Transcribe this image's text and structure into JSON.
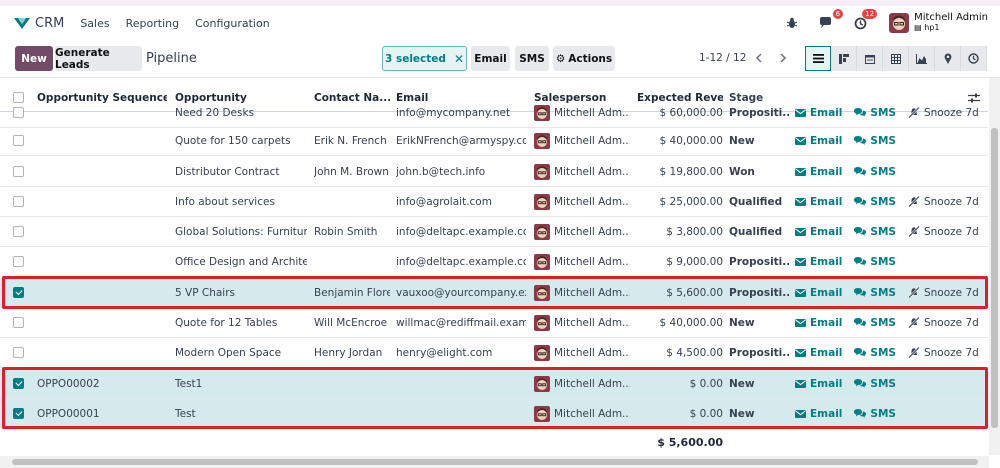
{
  "navbar": {
    "app_name": "CRM",
    "menu": [
      "Sales",
      "Reporting",
      "Configuration"
    ],
    "messages_badge": "6",
    "activities_badge": "12",
    "user_name": "Mitchell Admin",
    "user_db": "hp1"
  },
  "control": {
    "new_label": "New",
    "generate_label": "Generate Leads",
    "title": "Pipeline",
    "selected_label": "3 selected",
    "email_label": "Email",
    "sms_label": "SMS",
    "actions_label": "Actions",
    "pager": "1-12 / 12"
  },
  "colors": {
    "brand": "#714b67",
    "accent": "#017e84",
    "highlight": "#e11d2b",
    "selected_row": "#d5eaec"
  },
  "table": {
    "columns": [
      "Opportunity Sequence C...",
      "Opportunity",
      "Contact Na...",
      "Email",
      "Salesperson",
      "Expected Reven...",
      "Stage"
    ],
    "rows": [
      {
        "selected": false,
        "seq": "",
        "opp": "Need 20 Desks",
        "contact": "",
        "email": "info@mycompany.net",
        "sales": "Mitchell Adm...",
        "rev": "$ 60,000.00",
        "stage": "Propositi...",
        "email_act": "Email",
        "sms_act": "SMS",
        "snooze": "Snooze 7d"
      },
      {
        "selected": false,
        "seq": "",
        "opp": "Quote for 150 carpets",
        "contact": "Erik N. French",
        "email": "ErikNFrench@armyspy.com",
        "sales": "Mitchell Adm...",
        "rev": "$ 40,000.00",
        "stage": "New",
        "email_act": "Email",
        "sms_act": "SMS",
        "snooze": ""
      },
      {
        "selected": false,
        "seq": "",
        "opp": "Distributor Contract",
        "contact": "John M. Brown",
        "email": "john.b@tech.info",
        "sales": "Mitchell Adm...",
        "rev": "$ 19,800.00",
        "stage": "Won",
        "email_act": "Email",
        "sms_act": "SMS",
        "snooze": ""
      },
      {
        "selected": false,
        "seq": "",
        "opp": "Info about services",
        "contact": "",
        "email": "info@agrolait.com",
        "sales": "Mitchell Adm...",
        "rev": "$ 25,000.00",
        "stage": "Qualified",
        "email_act": "Email",
        "sms_act": "SMS",
        "snooze": "Snooze 7d"
      },
      {
        "selected": false,
        "seq": "",
        "opp": "Global Solutions: Furnitures",
        "contact": "Robin Smith",
        "email": "info@deltapc.example.com",
        "sales": "Mitchell Adm...",
        "rev": "$ 3,800.00",
        "stage": "Qualified",
        "email_act": "Email",
        "sms_act": "SMS",
        "snooze": "Snooze 7d"
      },
      {
        "selected": false,
        "seq": "",
        "opp": "Office Design and Architect...",
        "contact": "",
        "email": "info@deltapc.example.com",
        "sales": "Mitchell Adm...",
        "rev": "$ 9,000.00",
        "stage": "Propositi...",
        "email_act": "Email",
        "sms_act": "SMS",
        "snooze": ""
      },
      {
        "selected": true,
        "seq": "",
        "opp": "5 VP Chairs",
        "contact": "Benjamin Flores",
        "email": "vauxoo@yourcompany.exa...",
        "sales": "Mitchell Adm...",
        "rev": "$ 5,600.00",
        "stage": "Propositi...",
        "email_act": "Email",
        "sms_act": "SMS",
        "snooze": "Snooze 7d"
      },
      {
        "selected": false,
        "seq": "",
        "opp": "Quote for 12 Tables",
        "contact": "Will McEncroe",
        "email": "willmac@rediffmail.exampl...",
        "sales": "Mitchell Adm...",
        "rev": "$ 40,000.00",
        "stage": "New",
        "email_act": "Email",
        "sms_act": "SMS",
        "snooze": "Snooze 7d"
      },
      {
        "selected": false,
        "seq": "",
        "opp": "Modern Open Space",
        "contact": "Henry Jordan",
        "email": "henry@elight.com",
        "sales": "Mitchell Adm...",
        "rev": "$ 4,500.00",
        "stage": "Propositi...",
        "email_act": "Email",
        "sms_act": "SMS",
        "snooze": "Snooze 7d"
      },
      {
        "selected": true,
        "seq": "OPPO00002",
        "opp": "Test1",
        "contact": "",
        "email": "",
        "sales": "Mitchell Adm...",
        "rev": "$ 0.00",
        "stage": "New",
        "email_act": "Email",
        "sms_act": "SMS",
        "snooze": ""
      },
      {
        "selected": true,
        "seq": "OPPO00001",
        "opp": "Test",
        "contact": "",
        "email": "",
        "sales": "Mitchell Adm...",
        "rev": "$ 0.00",
        "stage": "New",
        "email_act": "Email",
        "sms_act": "SMS",
        "snooze": ""
      }
    ],
    "total": "$ 5,600.00"
  }
}
